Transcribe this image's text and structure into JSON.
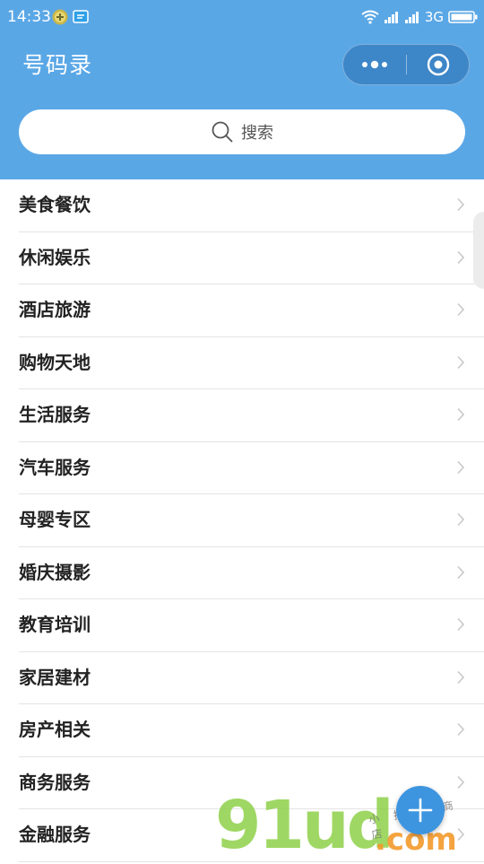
{
  "status_bar": {
    "time": "14:33",
    "network": "3G"
  },
  "header": {
    "title": "号码录",
    "search_placeholder": "搜索"
  },
  "categories": [
    {
      "label": "美食餐饮"
    },
    {
      "label": "休闲娱乐"
    },
    {
      "label": "酒店旅游"
    },
    {
      "label": "购物天地"
    },
    {
      "label": "生活服务"
    },
    {
      "label": "汽车服务"
    },
    {
      "label": "母婴专区"
    },
    {
      "label": "婚庆摄影"
    },
    {
      "label": "教育培训"
    },
    {
      "label": "家居建材"
    },
    {
      "label": "房产相关"
    },
    {
      "label": "商务服务"
    },
    {
      "label": "金融服务"
    }
  ],
  "watermark": {
    "logo": "91ud",
    "domain": ".com",
    "slogan": "小 技 巧 商 店"
  },
  "colors": {
    "header_bg": "#5aa7e6",
    "capsule_bg": "#3d86c8",
    "fab_bg": "#3d95e0",
    "text": "#222222",
    "divider": "#e4e4e4"
  },
  "icons": [
    "wechat-icon",
    "message-icon",
    "wifi-icon",
    "signal-icon",
    "battery-icon",
    "more-dots-icon",
    "target-close-icon",
    "search-icon",
    "chevron-right-icon",
    "plus-icon"
  ]
}
